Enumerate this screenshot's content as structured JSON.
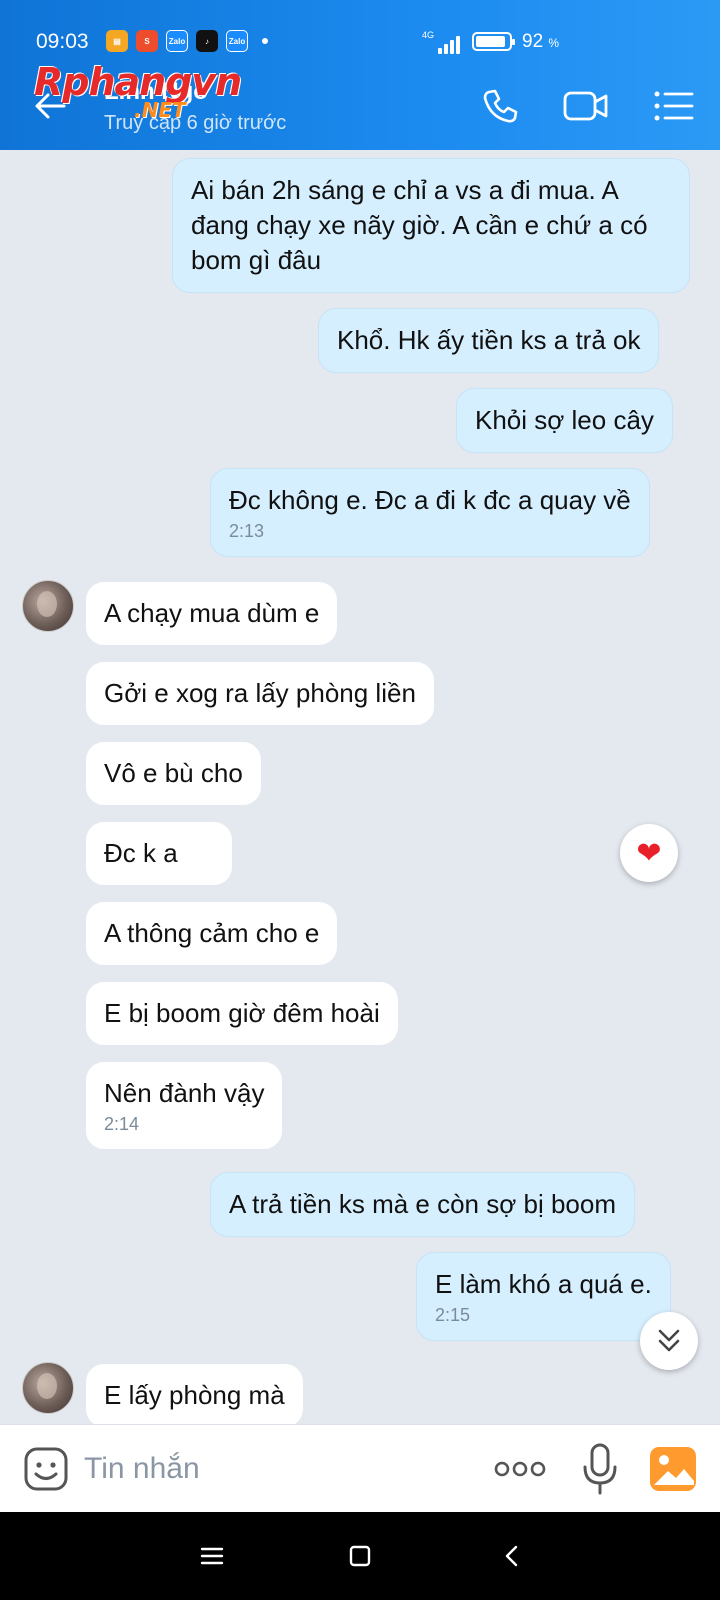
{
  "status_bar": {
    "time": "09:03",
    "network": "4G",
    "battery_percent": "92",
    "battery_unit": "%",
    "battery_level": 0.92,
    "notification_icons": [
      "notes-icon",
      "shopee-icon",
      "zalo-icon",
      "tiktok-icon",
      "zalo-icon"
    ],
    "zalo_label": "Zalo"
  },
  "header": {
    "contact_name": "Linh Ngô",
    "status": "Truy cập 6 giờ trước",
    "watermark": "Rphangvn",
    "watermark_sub": ".NET",
    "icons": [
      "back-arrow-icon",
      "phone-icon",
      "video-call-icon",
      "menu-icon"
    ]
  },
  "messages": [
    {
      "side": "sent",
      "text": "Ai bán 2h sáng e chỉ a vs a đi mua. A đang chạy xe nãy giờ. A cần e chứ a có bom gì đâu",
      "time": ""
    },
    {
      "side": "sent",
      "text": "Khổ. Hk ấy tiền ks a trả ok",
      "time": ""
    },
    {
      "side": "sent",
      "text": "Khỏi sợ leo cây",
      "time": ""
    },
    {
      "side": "sent",
      "text": "Đc không e. Đc a đi k đc a quay về",
      "time": "2:13"
    },
    {
      "side": "recv",
      "text": "A chạy mua dùm e",
      "time": ""
    },
    {
      "side": "recv",
      "text": "Gởi e xog ra lấy phòng liền",
      "time": ""
    },
    {
      "side": "recv",
      "text": "Vô e bù cho",
      "time": ""
    },
    {
      "side": "recv",
      "text": "Đc k a",
      "time": ""
    },
    {
      "side": "recv",
      "text": "A thông cảm cho e",
      "time": ""
    },
    {
      "side": "recv",
      "text": "E bị boom giờ đêm hoài",
      "time": ""
    },
    {
      "side": "recv",
      "text": "Nên đành vậy",
      "time": "2:14"
    },
    {
      "side": "sent",
      "text": "A trả tiền ks mà e còn sợ bị boom",
      "time": ""
    },
    {
      "side": "sent",
      "text": "E làm khó a quá e.",
      "time": "2:15"
    },
    {
      "side": "recv",
      "text": "E lấy phòng mà",
      "time": ""
    }
  ],
  "reaction": {
    "icon": "heart-icon",
    "glyph": "❤"
  },
  "input": {
    "placeholder": "Tin nhắn"
  },
  "colors": {
    "header": "#1c8bf0",
    "sent_bubble": "#d6efff",
    "recv_bubble": "#ffffff",
    "chat_background": "#e4e8ef",
    "heart": "#e8202a",
    "image_button": "#ff9a2e"
  }
}
